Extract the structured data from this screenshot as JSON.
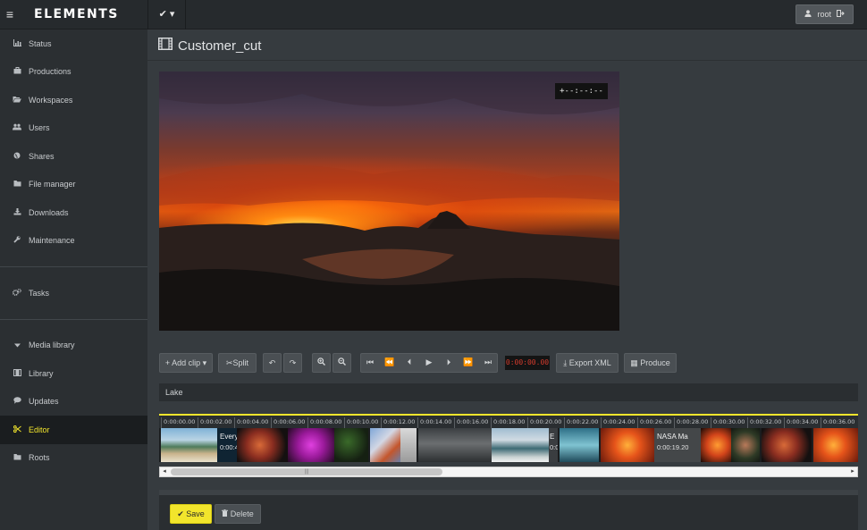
{
  "topbar": {
    "logo": "ELEMENTS",
    "check_menu": "✔ ▾",
    "user": "root"
  },
  "sidebar": {
    "items": [
      {
        "label": "Status",
        "icon": "chart-icon"
      },
      {
        "label": "Productions",
        "icon": "briefcase-icon"
      },
      {
        "label": "Workspaces",
        "icon": "folder-open-icon"
      },
      {
        "label": "Users",
        "icon": "users-icon"
      },
      {
        "label": "Shares",
        "icon": "globe-icon"
      },
      {
        "label": "File manager",
        "icon": "folder-icon"
      },
      {
        "label": "Downloads",
        "icon": "download-icon"
      },
      {
        "label": "Maintenance",
        "icon": "wrench-icon"
      },
      {
        "label": "Tasks",
        "icon": "cogs-icon"
      },
      {
        "label": "Media library",
        "icon": "caret-down-icon"
      },
      {
        "label": "Library",
        "icon": "film-icon"
      },
      {
        "label": "Updates",
        "icon": "comment-icon"
      },
      {
        "label": "Editor",
        "icon": "scissors-icon"
      },
      {
        "label": "Roots",
        "icon": "folder-icon"
      }
    ],
    "active": "Editor",
    "accent_color": "#f2e52c"
  },
  "page": {
    "title": "Customer_cut"
  },
  "player": {
    "timecode": "+--:--:--"
  },
  "toolbar": {
    "add_clip": "Add clip",
    "split": "Split",
    "counter": "0:00:00.00",
    "export_xml": "Export XML",
    "produce": "Produce"
  },
  "track": {
    "label": "Lake"
  },
  "timeline": {
    "ticks": [
      "0:00:00.00",
      "0:00:02.00",
      "0:00:04.00",
      "0:00:06.00",
      "0:00:08.00",
      "0:00:10.00",
      "0:00:12.00",
      "0:00:14.00",
      "0:00:16.00",
      "0:00:18.00",
      "0:00:20.00",
      "0:00:22.00",
      "0:00:24.00",
      "0:00:26.00",
      "0:00:28.00",
      "0:00:30.00",
      "0:00:32.00",
      "0:00:34.00",
      "0:00:36.00"
    ],
    "clip_labels": [
      {
        "title": "Every",
        "duration": "0:00:4"
      },
      {
        "title": "E",
        "duration": "0:0"
      },
      {
        "title": "NASA Ma",
        "duration": "0:00:19.20"
      }
    ]
  },
  "scrollbar": {
    "left_arrow": "◂",
    "right_arrow": "▸",
    "thumb_grip": "|||"
  },
  "footer": {
    "save": "Save",
    "delete": "Delete"
  }
}
